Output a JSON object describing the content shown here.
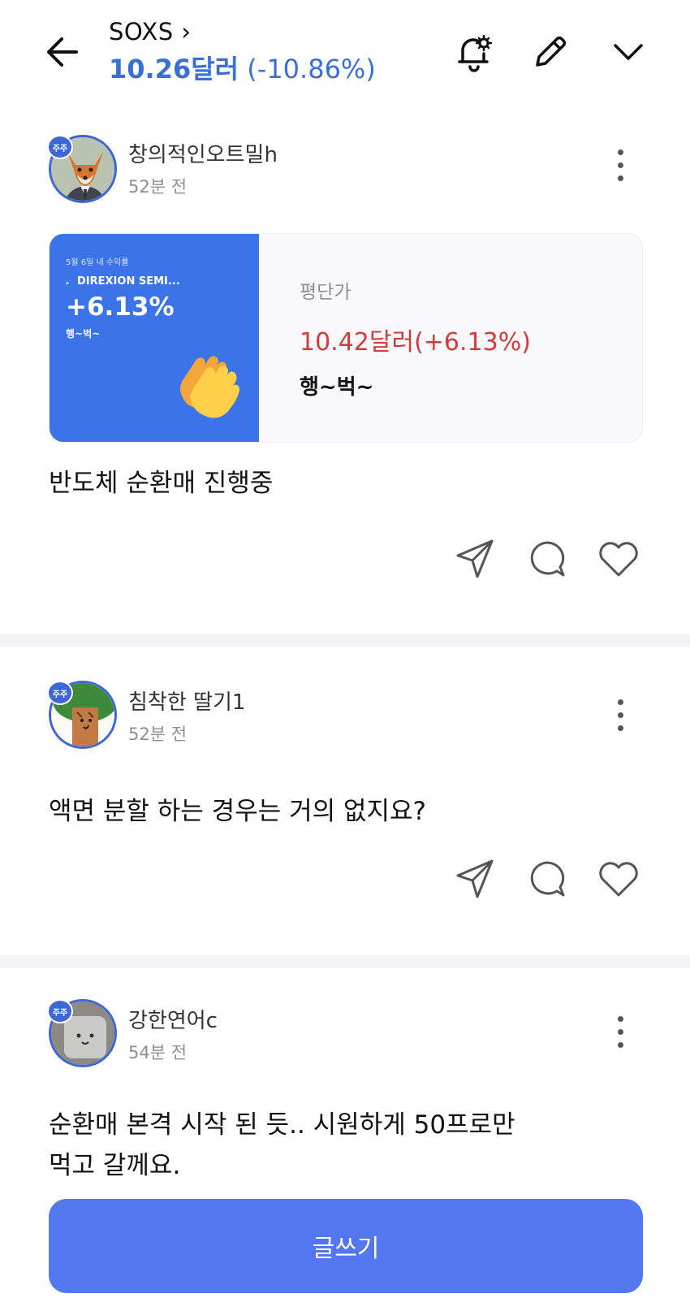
{
  "header": {
    "ticker": "SOXS",
    "price": "10.26달러",
    "change": "(-10.86%)",
    "icons": [
      "back-arrow-icon",
      "bell-settings-icon",
      "pencil-icon",
      "chevron-down-icon"
    ]
  },
  "posts": [
    {
      "badge": "주주",
      "username": "창의적인오트밀h",
      "time": "52분 전",
      "card": {
        "date_caption": "5월 6일 내 수익률",
        "fund": "DIREXION SEMI...",
        "percent": "+6.13%",
        "sub": "행~벅~",
        "avg_label": "평단가",
        "avg_price": "10.42달러(+6.13%)",
        "comment": "행~벅~"
      },
      "text": "반도체 순환매 진행중"
    },
    {
      "badge": "주주",
      "username": "침착한 딸기1",
      "time": "52분 전",
      "text": "액면 분할 하는 경우는 거의 없지요?"
    },
    {
      "badge": "주주",
      "username": "강한연어c",
      "time": "54분 전",
      "text_line1": "순환매 본격 시작 된 듯.. 시원하게 50프로만",
      "text_line2": "먹고 갈께요."
    }
  ],
  "write_button": "글쓰기",
  "colors": {
    "accent": "#3b6fd8",
    "card_blue": "#3b73e8",
    "profit_red": "#d23b3b",
    "write_button": "#5277ef"
  }
}
